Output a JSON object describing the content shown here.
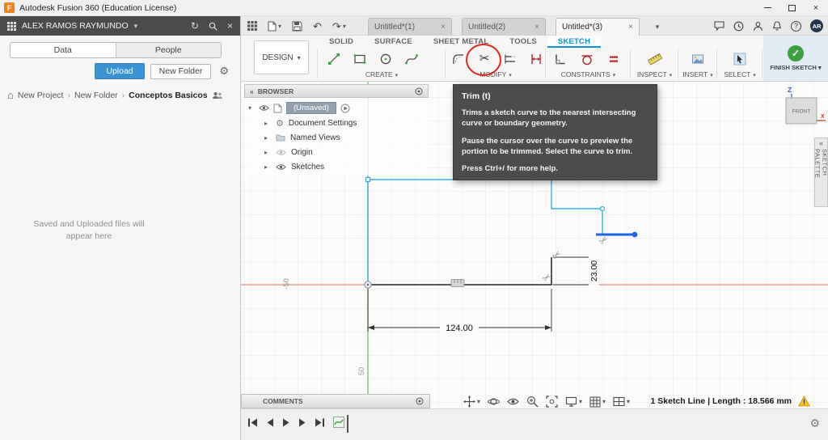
{
  "colors": {
    "accent_blue": "#0696d7",
    "selected_line_blue": "#1b66e0",
    "sketch_curve_cyan": "#35b5e5",
    "axis_x_red": "#e07a67",
    "axis_y_green": "#7cc576",
    "finish_green": "#3aa23f",
    "annotation_red": "#e02420",
    "warning_yellow": "#f2c21c",
    "tooltip_bg": "#4c4c4c",
    "unsaved_chip": "#93a1ad"
  },
  "glyphs": {
    "logo": "F",
    "chevron_down": "▾",
    "chevron_right": "▸",
    "crumb_sep": "›",
    "close": "×",
    "refresh": "↻",
    "undo": "↶",
    "redo": "↷",
    "gear": "⚙",
    "home": "⌂",
    "scissors": "✂",
    "check": "✓",
    "collapse": "«",
    "question": "?",
    "warning": "!"
  },
  "titlebar": {
    "title": "Autodesk Fusion 360 (Education License)"
  },
  "data_panel": {
    "user": "ALEX RAMOS RAYMUNDO",
    "tabs": {
      "data": "Data",
      "people": "People"
    },
    "upload": "Upload",
    "new_folder": "New Folder",
    "breadcrumb": [
      "New Project",
      "New Folder",
      "Conceptos Basicos"
    ],
    "empty_state": "Saved and Uploaded files will appear here"
  },
  "topbar": {
    "doc_tabs": [
      {
        "label": "Untitled*(1)"
      },
      {
        "label": "Untitled(2)"
      },
      {
        "label": "Untitled*(3)"
      }
    ],
    "avatar": "AR"
  },
  "ribbon": {
    "environment": "DESIGN",
    "tabs": [
      "SOLID",
      "SURFACE",
      "SHEET METAL",
      "TOOLS",
      "SKETCH"
    ],
    "groups": [
      {
        "label": "CREATE"
      },
      {
        "label": "MODIFY"
      },
      {
        "label": "CONSTRAINTS"
      },
      {
        "label": "INSPECT"
      },
      {
        "label": "INSERT"
      },
      {
        "label": "SELECT"
      },
      {
        "label": "FINISH SKETCH"
      }
    ]
  },
  "browser": {
    "header": "BROWSER",
    "root": "(Unsaved)",
    "items": [
      {
        "label": "Document Settings"
      },
      {
        "label": "Named Views"
      },
      {
        "label": "Origin"
      },
      {
        "label": "Sketches"
      }
    ]
  },
  "tooltip": {
    "title": "Trim (t)",
    "p1": "Trims a sketch curve to the nearest intersecting curve or boundary geometry.",
    "p2": "Pause the cursor over the curve to preview the portion to be trimmed. Select the curve to trim.",
    "p3": "Press Ctrl+/ for more help."
  },
  "canvas": {
    "dim_horizontal": "124.00",
    "dim_vertical": "23.00",
    "grid_label_left": "-50",
    "grid_label_bottom": "50",
    "viewcube": {
      "front": "FRONT",
      "z": "Z",
      "x": "X"
    }
  },
  "sketch_palette": {
    "label": "SKETCH PALETTE"
  },
  "comments": {
    "label": "COMMENTS"
  },
  "status": {
    "selection_info": "1 Sketch Line | Length : 18.566 mm"
  }
}
